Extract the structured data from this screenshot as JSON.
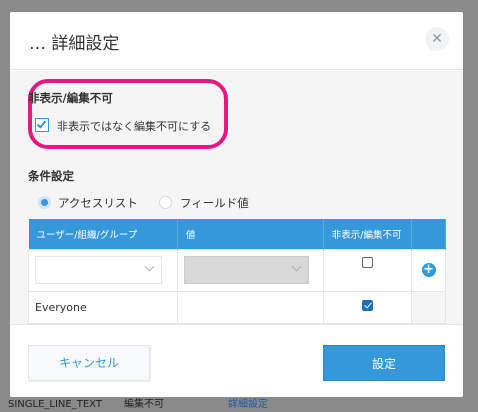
{
  "background": {
    "text_left": "SINGLE_LINE_TEXT",
    "text_mid": "編集不可",
    "text_right": "詳細設定"
  },
  "dialog": {
    "title": "… 詳細設定",
    "close_icon": "close-icon"
  },
  "hide_section": {
    "title": "非表示/編集不可",
    "checkbox_label": "非表示ではなく編集不可にする",
    "checkbox_checked": true
  },
  "condition": {
    "title": "条件設定",
    "radio_access_list": "アクセスリスト",
    "radio_field_value": "フィールド値",
    "selected": "アクセスリスト"
  },
  "table": {
    "headers": [
      "ユーザー/組織/グループ",
      "値",
      "非表示/編集不可",
      ""
    ],
    "rows": [
      {
        "user": "",
        "value": "",
        "checked": false
      },
      {
        "user": "Everyone",
        "value": "",
        "checked": true
      }
    ]
  },
  "footer": {
    "cancel_label": "キャンセル",
    "ok_label": "設定"
  },
  "colors": {
    "accent": "#3498db",
    "highlight": "#e4197f"
  }
}
